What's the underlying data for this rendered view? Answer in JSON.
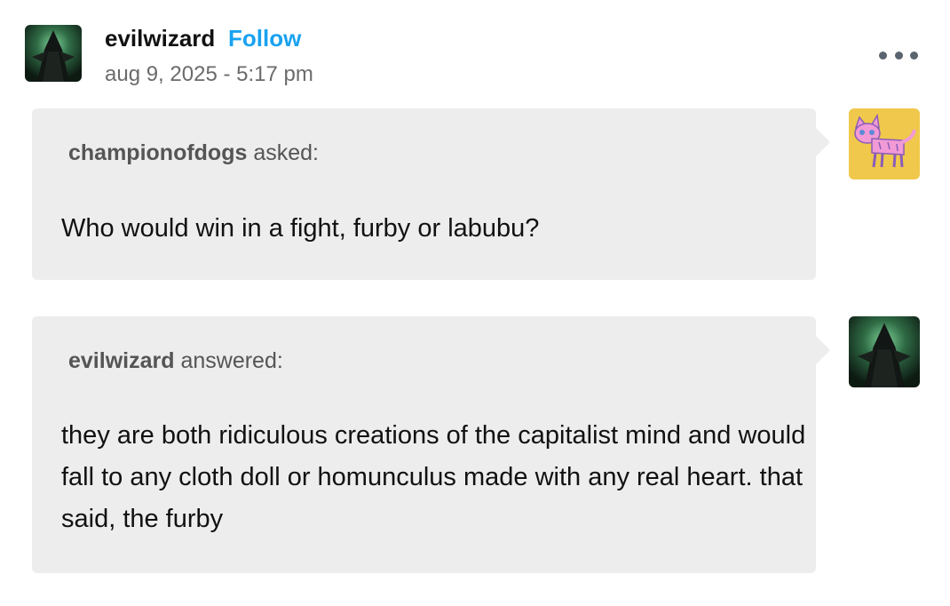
{
  "post": {
    "author": "evilwizard",
    "follow_label": "Follow",
    "timestamp": "aug 9, 2025 - 5:17 pm",
    "more_menu_icon": "ellipsis-icon"
  },
  "ask": {
    "asker": "championofdogs",
    "verb": "asked:",
    "question": "Who would win in a fight, furby or labubu?"
  },
  "answer": {
    "answerer": "evilwizard",
    "verb": "answered:",
    "text": "they are both ridiculous creations of the capitalist mind and would fall to any cloth doll or homunculus made with any real heart. that said, the furby"
  },
  "colors": {
    "follow": "#19a2ef",
    "bubble": "#ededed",
    "asker_avatar_bg": "#f0c84b"
  }
}
